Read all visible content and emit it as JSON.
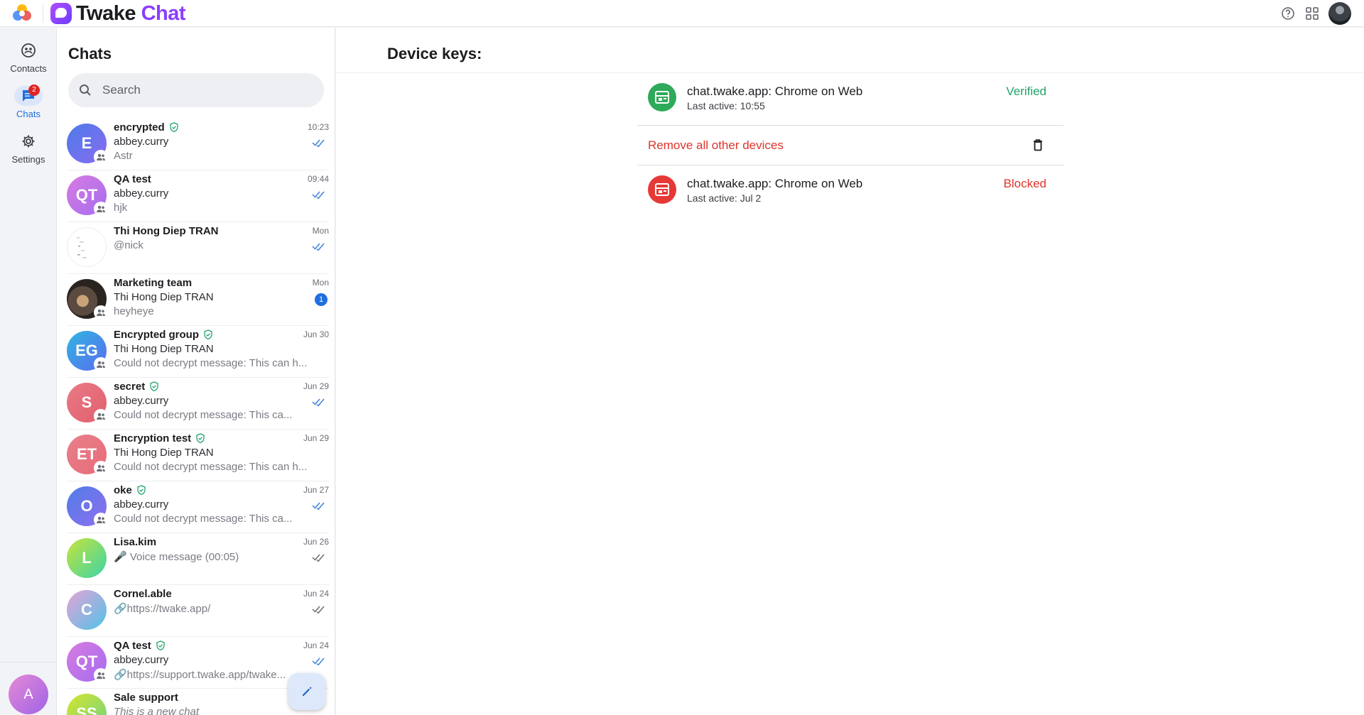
{
  "app": {
    "brand_word1": "Twake",
    "brand_word2": "Chat"
  },
  "colors": {
    "accent": "#1f6fe0",
    "brand": "#8a3dff",
    "verified": "#21a46b",
    "danger": "#e0342c"
  },
  "topbar": {
    "icons": [
      "help-icon",
      "apps-grid-icon",
      "user-avatar"
    ]
  },
  "rail": {
    "items": [
      {
        "label": "Contacts",
        "icon": "contacts-icon"
      },
      {
        "label": "Chats",
        "icon": "chat-bubble-icon",
        "badge": "2"
      },
      {
        "label": "Settings",
        "icon": "gear-icon"
      }
    ],
    "user_initial": "A"
  },
  "chats": {
    "title": "Chats",
    "search_placeholder": "Search",
    "list": [
      {
        "initials": "E",
        "name": "encrypted",
        "sender": "abbey.curry",
        "preview": "Astr",
        "time": "10:23"
      },
      {
        "initials": "QT",
        "name": "QA test",
        "sender": "abbey.curry",
        "preview": "hjk",
        "time": "09:44"
      },
      {
        "initials": "",
        "name": "Thi Hong Diep TRAN",
        "sender": "",
        "preview": "@nick",
        "time": "Mon"
      },
      {
        "initials": "",
        "name": "Marketing team",
        "sender": "Thi Hong Diep TRAN",
        "preview": "heyheye",
        "time": "Mon",
        "unread": "1"
      },
      {
        "initials": "EG",
        "name": "Encrypted group",
        "sender": "Thi Hong Diep TRAN",
        "preview": "Could not decrypt message: This can h...",
        "time": "Jun 30"
      },
      {
        "initials": "S",
        "name": "secret",
        "sender": "abbey.curry",
        "preview": "Could not decrypt message: This ca...",
        "time": "Jun 29"
      },
      {
        "initials": "ET",
        "name": "Encryption test",
        "sender": "Thi Hong Diep TRAN",
        "preview": "Could not decrypt message: This can h...",
        "time": "Jun 29"
      },
      {
        "initials": "O",
        "name": "oke",
        "sender": "abbey.curry",
        "preview": "Could not decrypt message: This ca...",
        "time": "Jun 27"
      },
      {
        "initials": "L",
        "name": "Lisa.kim",
        "sender": "",
        "preview": "🎤 Voice message (00:05)",
        "time": "Jun 26"
      },
      {
        "initials": "C",
        "name": "Cornel.able",
        "sender": "",
        "preview": "🔗https://twake.app/",
        "time": "Jun 24"
      },
      {
        "initials": "QT",
        "name": "QA test",
        "sender": "abbey.curry",
        "preview": "🔗https://support.twake.app/twake...",
        "time": "Jun 24"
      },
      {
        "initials": "SS",
        "name": "Sale support",
        "sender": "",
        "preview": "This is a new chat",
        "time": ""
      }
    ]
  },
  "main": {
    "title": "Device keys:",
    "devices": [
      {
        "name": "chat.twake.app: Chrome on Web",
        "last_active": "Last active: 10:55",
        "status": "Verified"
      },
      {
        "name": "chat.twake.app: Chrome on Web",
        "last_active": "Last active: Jul 2",
        "status": "Blocked"
      }
    ],
    "remove_all_label": "Remove all other devices"
  }
}
